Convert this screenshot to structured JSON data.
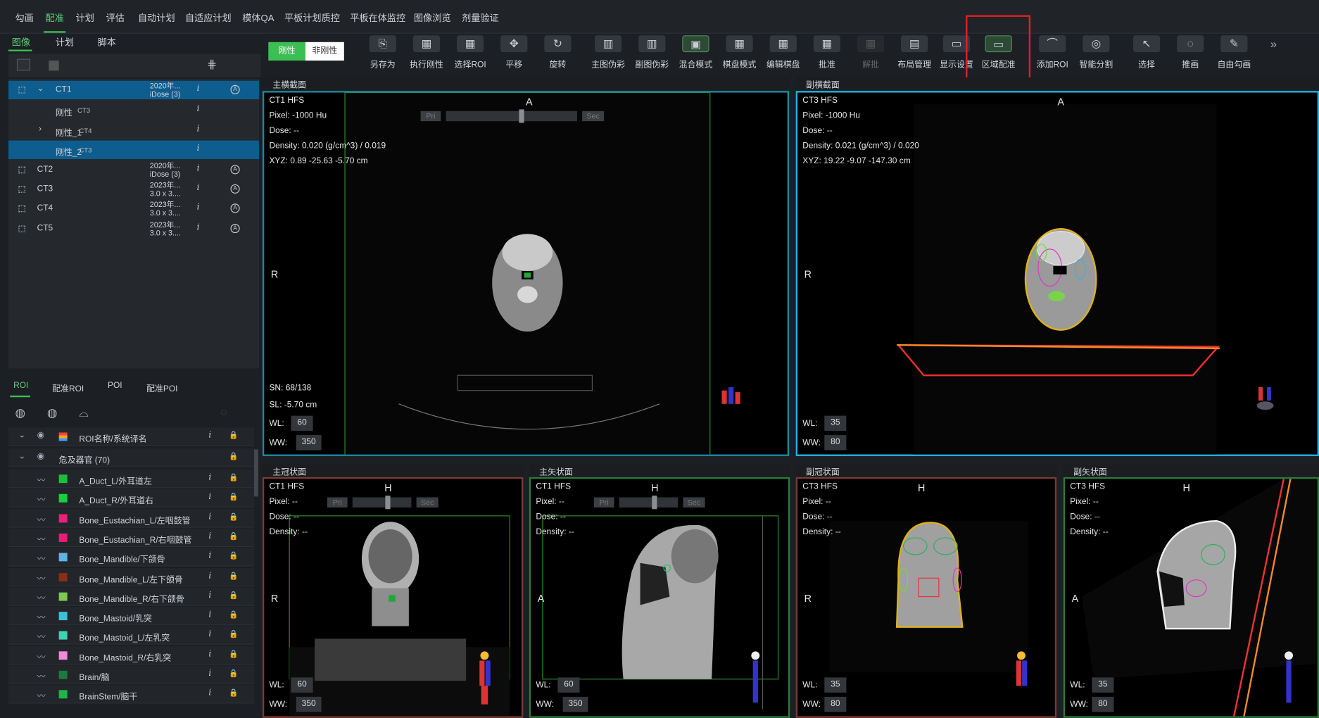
{
  "menu": [
    "勾画",
    "配准",
    "计划",
    "评估",
    "自动计划",
    "自适应计划",
    "模体QA",
    "平板计划质控",
    "平板在体监控",
    "图像浏览",
    "剂量验证"
  ],
  "left_tabs": [
    "图像",
    "计划",
    "脚本"
  ],
  "series_tree": [
    {
      "name": "CT1",
      "date": "2020年...",
      "desc": "iDose (3)",
      "selected": true,
      "expanded": true
    },
    {
      "name": "刚性",
      "tag": "CT3"
    },
    {
      "name": "刚性_1",
      "tag": "CT4",
      "collapsed": true
    },
    {
      "name": "刚性_2",
      "tag": "CT3",
      "selected": true
    },
    {
      "name": "CT2",
      "date": "2020年...",
      "desc": "iDose (3)"
    },
    {
      "name": "CT3",
      "date": "2023年...",
      "desc": "3.0 x 3...."
    },
    {
      "name": "CT4",
      "date": "2023年...",
      "desc": "3.0 x 3...."
    },
    {
      "name": "CT5",
      "date": "2023年...",
      "desc": "3.0 x 3...."
    }
  ],
  "roi_tabs": [
    "ROI",
    "配准ROI",
    "POI",
    "配准POI"
  ],
  "roi_header": "ROI名称/系统译名",
  "roi_group": "危及器官 (70)",
  "roi_items": [
    {
      "name": "A_Duct_L/外耳道左",
      "color": "#15c23a"
    },
    {
      "name": "A_Duct_R/外耳道右",
      "color": "#15d13c"
    },
    {
      "name": "Bone_Eustachian_L/左咽鼓管",
      "color": "#ec1f79"
    },
    {
      "name": "Bone_Eustachian_R/右咽鼓管",
      "color": "#e81e76"
    },
    {
      "name": "Bone_Mandible/下颌骨",
      "color": "#58b7e8"
    },
    {
      "name": "Bone_Mandible_L/左下颌骨",
      "color": "#8b2e16"
    },
    {
      "name": "Bone_Mandible_R/右下颌骨",
      "color": "#7fc94c"
    },
    {
      "name": "Bone_Mastoid/乳突",
      "color": "#3bc2d6"
    },
    {
      "name": "Bone_Mastoid_L/左乳突",
      "color": "#3ed3b2"
    },
    {
      "name": "Bone_Mastoid_R/右乳突",
      "color": "#f08ad9"
    },
    {
      "name": "Brain/脑",
      "color": "#1b7a3d"
    },
    {
      "name": "BrainStem/脑干",
      "color": "#19b84b"
    }
  ],
  "mode": {
    "rigid": "刚性",
    "nonrigid": "非刚性"
  },
  "toolbar": [
    {
      "label": "另存为",
      "icon": "save-as-icon",
      "glyph": "⎘"
    },
    {
      "label": "执行刚性",
      "icon": "execute-rigid-icon",
      "glyph": "▦"
    },
    {
      "label": "选择ROI",
      "icon": "select-roi-icon",
      "glyph": "▦"
    },
    {
      "label": "平移",
      "icon": "pan-icon",
      "glyph": "✥"
    },
    {
      "label": "旋转",
      "icon": "rotate-icon",
      "glyph": "↻"
    },
    {
      "label": "主图伪彩",
      "icon": "primary-pseudocolor-icon",
      "glyph": "▥"
    },
    {
      "label": "副图伪彩",
      "icon": "secondary-pseudocolor-icon",
      "glyph": "▥"
    },
    {
      "label": "混合模式",
      "icon": "blend-mode-icon",
      "glyph": "▣"
    },
    {
      "label": "棋盘模式",
      "icon": "checkerboard-mode-icon",
      "glyph": "▦"
    },
    {
      "label": "编辑棋盘",
      "icon": "edit-checkerboard-icon",
      "glyph": "▦"
    },
    {
      "label": "批准",
      "icon": "approve-icon",
      "glyph": "▦"
    },
    {
      "label": "解批",
      "icon": "unapprove-icon",
      "glyph": "▦",
      "disabled": true
    },
    {
      "label": "布局管理",
      "icon": "layout-icon",
      "glyph": "▤"
    },
    {
      "label": "显示设置",
      "icon": "display-settings-icon",
      "glyph": "▭"
    },
    {
      "label": "区域配准",
      "icon": "region-registration-icon",
      "glyph": "▭"
    },
    {
      "label": "添加ROI",
      "icon": "add-roi-icon",
      "glyph": "⌒"
    },
    {
      "label": "智能分割",
      "icon": "smart-segment-icon",
      "glyph": "◎"
    },
    {
      "label": "选择",
      "icon": "select-icon",
      "glyph": "↖"
    },
    {
      "label": "推画",
      "icon": "push-draw-icon",
      "glyph": "◌"
    },
    {
      "label": "自由勾画",
      "icon": "free-draw-icon",
      "glyph": "✎"
    }
  ],
  "overflow": "»",
  "panels": {
    "main_axial": {
      "title": "主横截面",
      "image": "CT1 HFS",
      "pixel": "Pixel:  -1000 Hu",
      "dose": "Dose:  --",
      "density": "Density:  0.020 (g/cm^3) / 0.019",
      "xyz": "XYZ: 0.89 -25.63 -5.70 cm",
      "top": "A",
      "left": "R",
      "sn": "SN: 68/138",
      "sl": "SL: -5.70 cm",
      "wl": "60",
      "ww": "350",
      "pri": "Pri",
      "sec": "Sec"
    },
    "sec_axial": {
      "title": "副横截面",
      "image": "CT3 HFS",
      "pixel": "Pixel:  -1000 Hu",
      "dose": "Dose:  --",
      "density": "Density:  0.021 (g/cm^3) / 0.020",
      "xyz": "XYZ: 19.22 -9.07 -147.30 cm",
      "top": "A",
      "left": "R",
      "wl": "35",
      "ww": "80"
    },
    "main_coronal": {
      "title": "主冠状面",
      "image": "CT1 HFS",
      "pixel": "Pixel:  --",
      "dose": "Dose:  --",
      "density": "Density:  --",
      "top": "H",
      "left": "R",
      "wl": "60",
      "ww": "350",
      "pri": "Pri",
      "sec": "Sec"
    },
    "main_sagittal": {
      "title": "主矢状面",
      "image": "CT1 HFS",
      "pixel": "Pixel:  --",
      "dose": "Dose:  --",
      "density": "Density:  --",
      "top": "H",
      "left": "A",
      "wl": "60",
      "ww": "350",
      "pri": "Pri",
      "sec": "Sec"
    },
    "sec_coronal": {
      "title": "副冠状面",
      "image": "CT3 HFS",
      "pixel": "Pixel:  --",
      "dose": "Dose:  --",
      "density": "Density:  --",
      "top": "H",
      "left": "R",
      "wl": "35",
      "ww": "80"
    },
    "sec_sagittal": {
      "title": "副矢状面",
      "image": "CT3 HFS",
      "pixel": "Pixel:  --",
      "dose": "Dose:  --",
      "density": "Density:  --",
      "top": "H",
      "left": "A",
      "wl": "35",
      "ww": "80"
    }
  },
  "labels": {
    "wl": "WL:",
    "ww": "WW:"
  },
  "colors": {
    "selected_row": "#0d5d8e",
    "accent_green": "#3bbf53",
    "highlight_red": "#e21f26",
    "main_axial_border": "#1c8a9e",
    "sec_axial_border": "#1fb3e6",
    "coronal_border": "#7a3b38",
    "sagittal_border": "#2b7a3a"
  }
}
